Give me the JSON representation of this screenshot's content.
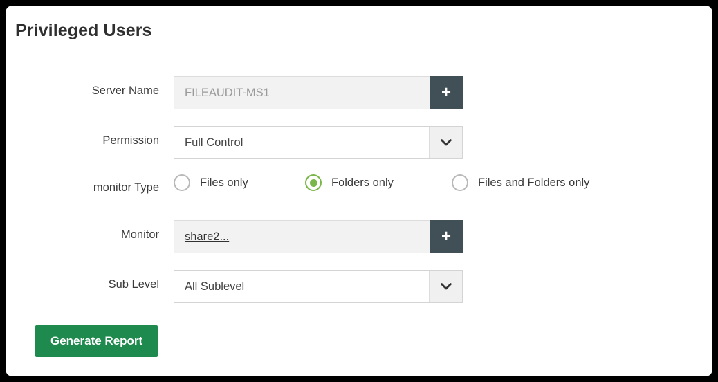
{
  "page": {
    "title": "Privileged Users"
  },
  "form": {
    "rows": [
      {
        "label": "Server Name",
        "type": "input-plus",
        "value": "FILEAUDIT-MS1",
        "placeholder": "FILEAUDIT-MS1",
        "button_label": "+",
        "button_icon": "plus-icon"
      },
      {
        "label": "Permission",
        "type": "select",
        "value": "Full Control",
        "button_icon": "chevron-down-icon"
      },
      {
        "label": "monitor Type",
        "type": "radio",
        "options": [
          {
            "label": "Files only",
            "selected": false
          },
          {
            "label": "Folders only",
            "selected": true
          },
          {
            "label": "Files and Folders only",
            "selected": false
          }
        ]
      },
      {
        "label": "Monitor",
        "type": "input-plus-link",
        "value": "share2...",
        "button_label": "+",
        "button_icon": "plus-icon"
      },
      {
        "label": "Sub Level",
        "type": "select",
        "value": "All Sublevel",
        "button_icon": "chevron-down-icon"
      }
    ]
  },
  "actions": {
    "generate_report_label": "Generate Report"
  },
  "colors": {
    "accent_green": "#1e8a4d",
    "radio_selected_green": "#7ab648",
    "plus_button_dark": "#414f57",
    "field_gray": "#f2f2f2",
    "title_text": "#2f2f2f"
  }
}
